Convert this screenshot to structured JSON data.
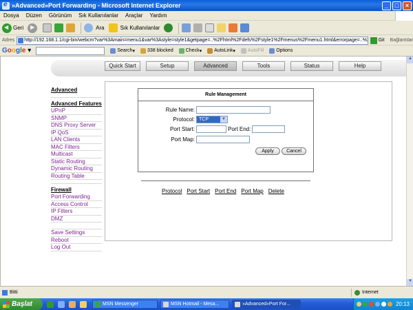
{
  "window": {
    "title": "»Advanced»Port Forwarding - Microsoft Internet Explorer",
    "controls": [
      "_",
      "□",
      "×"
    ]
  },
  "menu": [
    "Dosya",
    "Düzen",
    "Görünüm",
    "Sık Kullanılanlar",
    "Araçlar",
    "Yardım"
  ],
  "toolbar": {
    "back": "Geri",
    "search": "Ara",
    "favorites": "Sık Kullanılanlar"
  },
  "address": {
    "label": "Adres",
    "url": "http://192.168.1.1/cgi-bin/webcm?var%3Amain=menu1&var%3Astyle=style1&getpage=..%2Fhtml%2Fdefs%2Fstyle1%2Fmenus%2Fmenu1.html&errorpage=..%2Fl",
    "go": "Git",
    "links": "Bağlantılar"
  },
  "googlebar": {
    "logo": "Google",
    "search": "Search",
    "blocked": "338 blocked",
    "check": "Check",
    "autolink": "AutoLink",
    "autofill": "AutoFill",
    "options": "Options"
  },
  "nav": {
    "tabs": [
      "Quick Start",
      "Setup",
      "Advanced",
      "Tools",
      "Status",
      "Help"
    ],
    "active_tab": "Advanced"
  },
  "sidebar": {
    "heading_top": "Advanced",
    "heading_features": "Advanced Features",
    "features": [
      "UPnP",
      "SNMP",
      "DNS Proxy Server",
      "IP QoS",
      "LAN Clients",
      "MAC Filters",
      "Multicast",
      "Static Routing",
      "Dynamic Routing",
      "Routing Table"
    ],
    "heading_firewall": "Firewall",
    "firewall": [
      "Port Forwarding",
      "Access Control",
      "IP Filters",
      "DMZ"
    ],
    "footer": [
      "Save Settings",
      "Reboot",
      "Log Out"
    ]
  },
  "rule": {
    "title": "Rule Management",
    "rule_name_label": "Rule Name:",
    "rule_name_value": "",
    "protocol_label": "Protocol:",
    "protocol_value": "TCP",
    "port_start_label": "Port Start:",
    "port_start_value": "",
    "port_end_label": "Port End:",
    "port_end_value": "",
    "port_map_label": "Port Map:",
    "port_map_value": "",
    "apply": "Apply",
    "cancel": "Cancel",
    "columns": [
      "Protocol",
      "Port Start",
      "Port End",
      "Port Map",
      "Delete"
    ]
  },
  "statusbar": {
    "status": "Bitti",
    "zone": "Internet"
  },
  "taskbar": {
    "start": "Başlat",
    "tasks": [
      "MSN Messenger",
      "MSN Hotmail - Mesa...",
      "»Advanced»Port For..."
    ],
    "clock": "20:13"
  }
}
